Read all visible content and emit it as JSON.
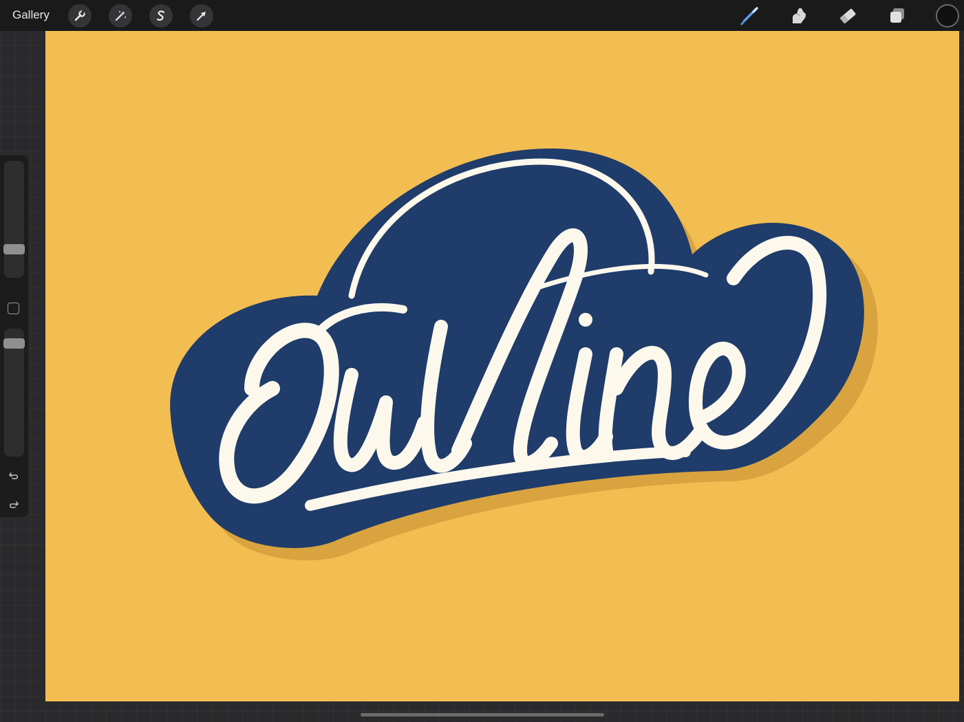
{
  "toolbar": {
    "gallery_label": "Gallery",
    "left_tools": [
      {
        "name": "actions",
        "icon": "wrench-icon"
      },
      {
        "name": "adjustments",
        "icon": "magic-wand-icon"
      },
      {
        "name": "selection",
        "icon": "selection-s-icon"
      },
      {
        "name": "transform",
        "icon": "arrow-cursor-icon"
      }
    ],
    "right_tools": [
      {
        "name": "brush",
        "icon": "brush-icon"
      },
      {
        "name": "smudge",
        "icon": "smudge-finger-icon"
      },
      {
        "name": "eraser",
        "icon": "eraser-icon"
      },
      {
        "name": "layers",
        "icon": "layers-icon"
      }
    ],
    "current_color": "#111111"
  },
  "sidebar": {
    "brush_size_level": 0.22,
    "opacity_level": 0.92,
    "undo_icon": "undo-icon",
    "redo_icon": "redo-icon"
  },
  "canvas": {
    "artwork_text": "Outline",
    "background_color": "#f2be52",
    "badge_color": "#1f3c6a",
    "lettering_color": "#fdf8ec",
    "shadow_color": "#d9a43f"
  }
}
